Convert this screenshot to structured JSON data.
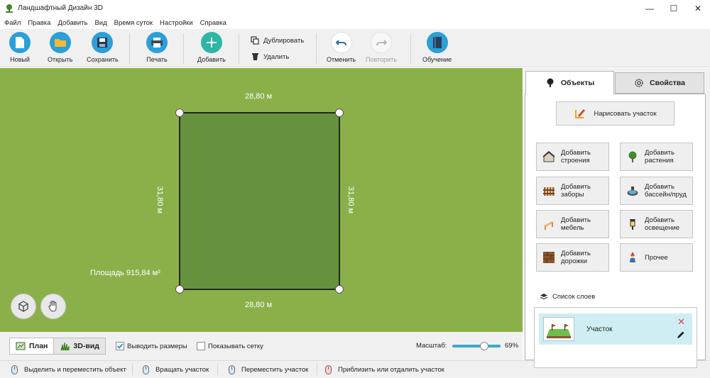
{
  "window": {
    "title": "Ландшафтный Дизайн 3D",
    "controls": {
      "minimize": "—",
      "maximize": "☐",
      "close": "✕"
    }
  },
  "menu": [
    "Файл",
    "Правка",
    "Добавить",
    "Вид",
    "Время суток",
    "Настройки",
    "Справка"
  ],
  "toolbar": {
    "new": "Новый",
    "open": "Открыть",
    "save": "Сохранить",
    "print": "Печать",
    "add": "Добавить",
    "duplicate": "Дублировать",
    "delete": "Удалить",
    "undo": "Отменить",
    "redo": "Повторить",
    "tutorial": "Обучение"
  },
  "plot": {
    "top_width": "28,80 м",
    "bottom_width": "28,80 м",
    "left_height": "31,80 м",
    "right_height": "31,80 м",
    "area": "Площадь 915,84 м²"
  },
  "viewbar": {
    "plan": "План",
    "view3d": "3D-вид",
    "show_dimensions": "Выводить размеры",
    "show_dimensions_checked": true,
    "show_grid": "Показывать сетку",
    "show_grid_checked": false,
    "zoom_label": "Масштаб:",
    "zoom_value": "69%",
    "zoom_fraction": 0.69
  },
  "statusbar": {
    "hint1": "Выделить и переместить объект",
    "hint2": "Вращать участок",
    "hint3": "Переместить участок",
    "hint4": "Приблизить или отдалить участок"
  },
  "panel": {
    "tab_objects": "Объекты",
    "tab_properties": "Свойства",
    "draw_plot": "Нарисовать участок",
    "add_buildings_1": "Добавить",
    "add_buildings_2": "строения",
    "add_plants_1": "Добавить",
    "add_plants_2": "растения",
    "add_fences_1": "Добавить",
    "add_fences_2": "заборы",
    "add_pool_1": "Добавить",
    "add_pool_2": "бассейн/пруд",
    "add_furniture_1": "Добавить",
    "add_furniture_2": "мебель",
    "add_lighting_1": "Добавить",
    "add_lighting_2": "освещение",
    "add_paths_1": "Добавить",
    "add_paths_2": "дорожки",
    "other": "Прочее",
    "layers_title": "Список слоев",
    "layers": [
      {
        "name": "Участок",
        "remove": "✕"
      }
    ]
  },
  "colors": {
    "grass": "#8bb04a",
    "plot_fill": "#66923e",
    "accent_teal": "#2fb5a5",
    "slider": "#3da9c8",
    "layer_selected": "#cfeef3"
  }
}
